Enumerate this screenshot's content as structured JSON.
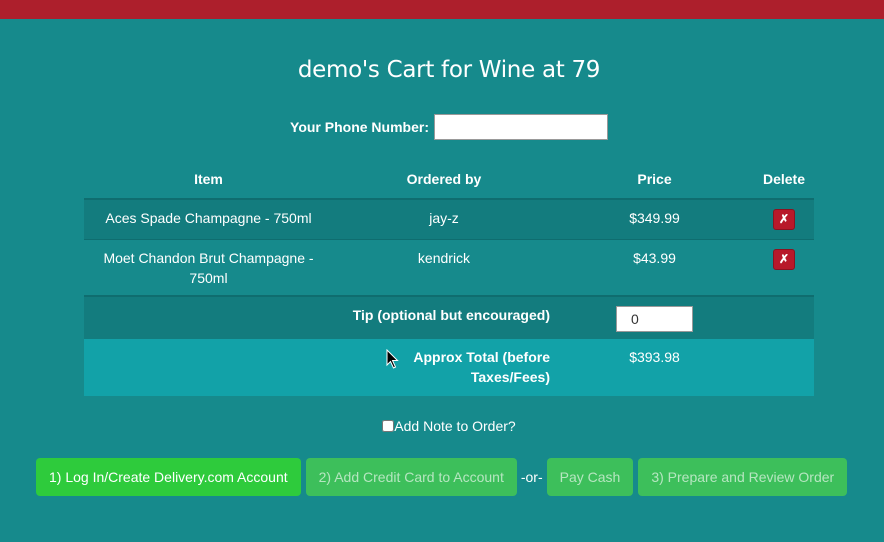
{
  "page": {
    "title": "demo's Cart for Wine at 79"
  },
  "phone": {
    "label": "Your Phone Number:",
    "value": ""
  },
  "table": {
    "headers": {
      "item": "Item",
      "ordered_by": "Ordered by",
      "price": "Price",
      "delete": "Delete"
    },
    "rows": [
      {
        "item": "Aces Spade Champagne - 750ml",
        "ordered_by": "jay-z",
        "price": "$349.99",
        "delete_glyph": "✗"
      },
      {
        "item": "Moet Chandon Brut Champagne - 750ml",
        "ordered_by": "kendrick",
        "price": "$43.99",
        "delete_glyph": "✗"
      }
    ],
    "tip": {
      "label": "Tip (optional but encouraged)",
      "value": "0"
    },
    "total": {
      "label": "Approx Total (before Taxes/Fees)",
      "value": "$393.98"
    }
  },
  "note": {
    "label": "Add Note to Order?",
    "checked": false
  },
  "actions": {
    "login": "1) Log In/Create Delivery.com Account",
    "add_card": "2) Add Credit Card to Account",
    "or": "-or-",
    "pay_cash": "Pay Cash",
    "review": "3) Prepare and Review Order"
  },
  "icons": {
    "delete": "close-icon",
    "cursor": "mouse-pointer-icon"
  },
  "colors": {
    "background": "#168a8c",
    "header_bar": "#ad1f2c",
    "primary_button": "#2ecb3c",
    "disabled_button": "#3dbf5b",
    "delete_button": "#b8192a"
  }
}
